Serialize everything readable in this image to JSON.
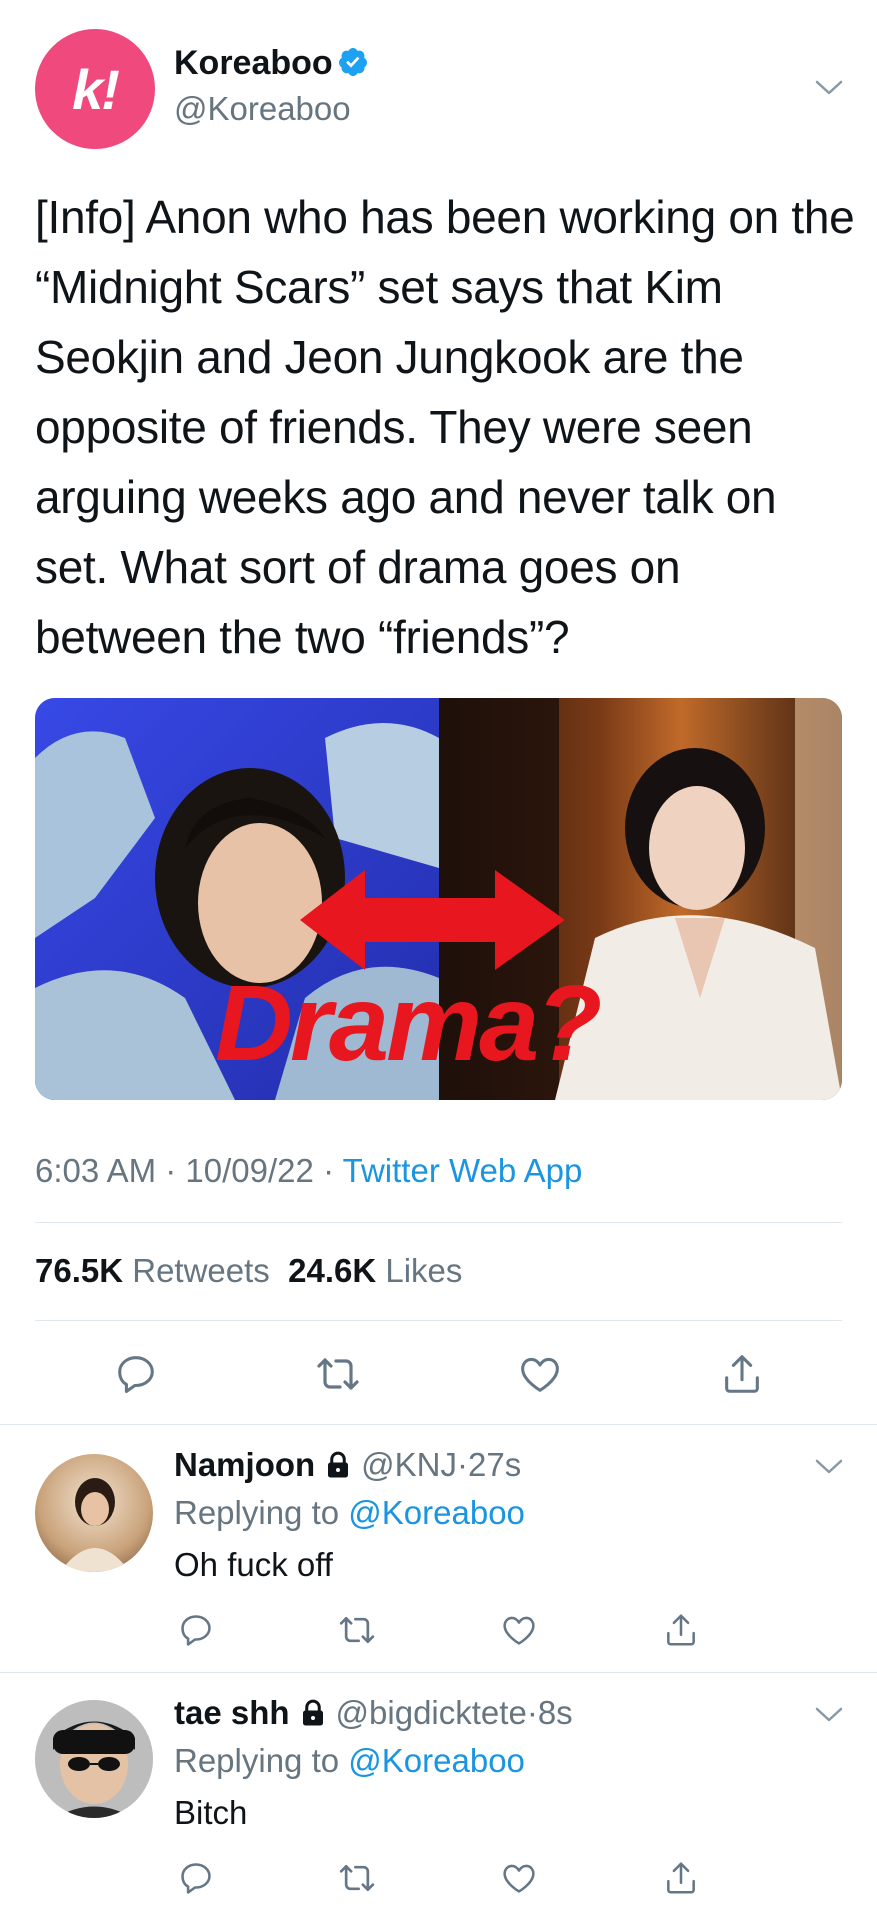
{
  "colors": {
    "accent": "#1b95e0",
    "text": "#0f1419",
    "secondary": "#66757f",
    "divider": "#e1e8ed",
    "brand_pink": "#f0497d"
  },
  "tweet": {
    "display_name": "Koreaboo",
    "handle": "@Koreaboo",
    "logo_text": "k!",
    "verified_icon": "verified-badge-icon",
    "text": "[Info] Anon who has been working on the “Midnight Scars” set says that Kim Seokjin and Jeon Jungkook are the opposite of friends. They were seen arguing weeks ago and never talk on set. What sort of drama goes on between the two “friends”?",
    "image": {
      "overlay_text": "Drama?"
    },
    "time": "6:03 AM",
    "date": "10/09/22",
    "source": "Twitter Web App",
    "retweets_count": "76.5K",
    "retweets_label": "Retweets",
    "likes_count": "24.6K",
    "likes_label": "Likes"
  },
  "replies": [
    {
      "display_name": "Namjoon",
      "handle": "@KNJ",
      "time": "27s",
      "replying_prefix": "Replying to",
      "replying_to": "@Koreaboo",
      "text": "Oh fuck off"
    },
    {
      "display_name": "tae shh",
      "handle": "@bigdicktete",
      "time": "8s",
      "replying_prefix": "Replying to",
      "replying_to": "@Koreaboo",
      "text": "Bitch"
    }
  ],
  "separator": "·"
}
